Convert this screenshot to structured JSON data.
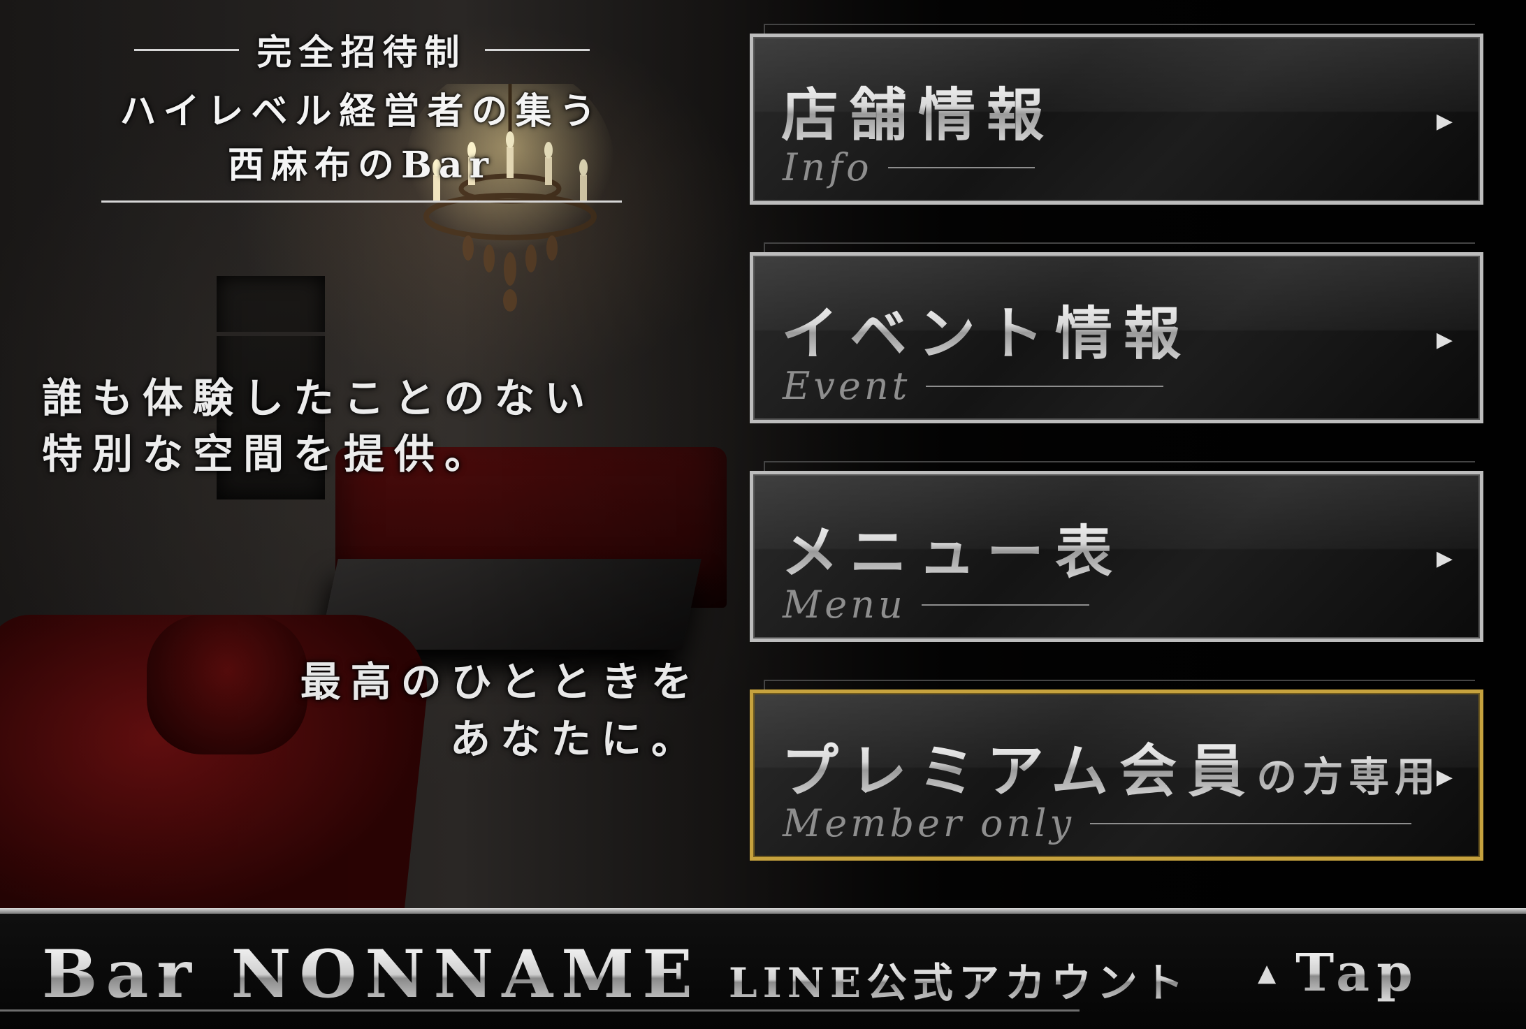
{
  "headline": {
    "line1": "完全招待制",
    "line2": "ハイレベル経営者の集う",
    "line3": "西麻布のBar"
  },
  "copy1": {
    "line1": "誰も体験したことのない",
    "line2": "特別な空間を提供。"
  },
  "copy2": {
    "line1": "最高のひとときを",
    "line2": "あなたに。"
  },
  "menu": [
    {
      "jp": "店舗情報",
      "en": "Info",
      "arrow": "▶"
    },
    {
      "jp": "イベント情報",
      "en": "Event",
      "arrow": "▶"
    },
    {
      "jp": "メニュー表",
      "en": "Menu",
      "arrow": "▶"
    },
    {
      "jp": "プレミアム会員",
      "jp_small": "の方専用",
      "en": "Member only",
      "arrow": "▶"
    }
  ],
  "footer": {
    "brand": "Bar NONNAME",
    "sub": "LINE公式アカウント",
    "tap_icon": "▲",
    "tap_label": "Tap"
  },
  "colors": {
    "border_silver": "#bdbdbd",
    "border_gold": "#c6a23e",
    "sofa_red": "#5a0c0c"
  }
}
